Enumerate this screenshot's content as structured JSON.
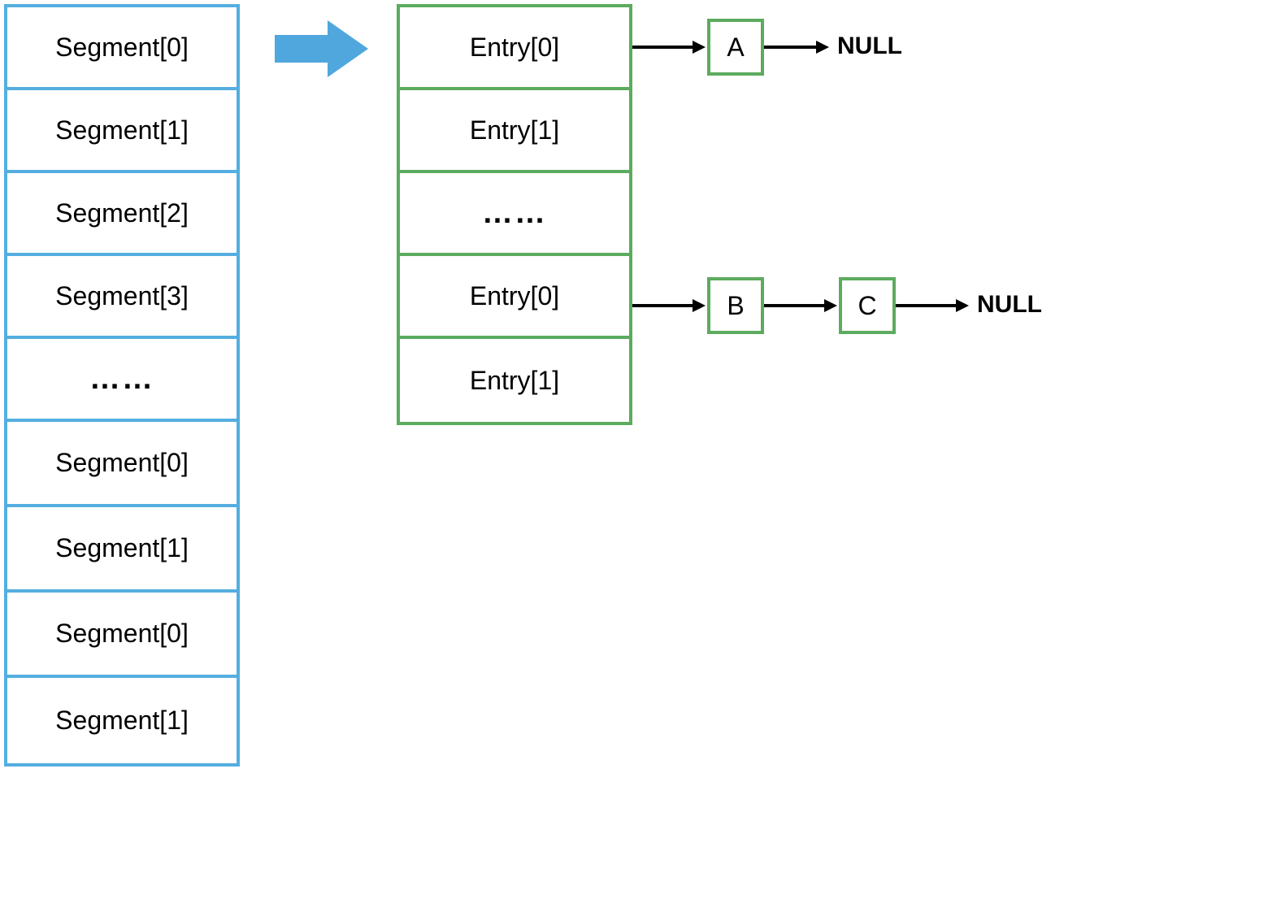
{
  "colors": {
    "blue": "#54AEE0",
    "green": "#5CAB5E",
    "arrowFill": "#4FA7DD",
    "black": "#000000"
  },
  "segments": [
    "Segment[0]",
    "Segment[1]",
    "Segment[2]",
    "Segment[3]",
    "……",
    "Segment[0]",
    "Segment[1]",
    "Segment[0]",
    "Segment[1]"
  ],
  "entries": [
    "Entry[0]",
    "Entry[1]",
    "……",
    "Entry[0]",
    "Entry[1]"
  ],
  "nodes": {
    "a": "A",
    "b": "B",
    "c": "C"
  },
  "nullLabel": "NULL"
}
